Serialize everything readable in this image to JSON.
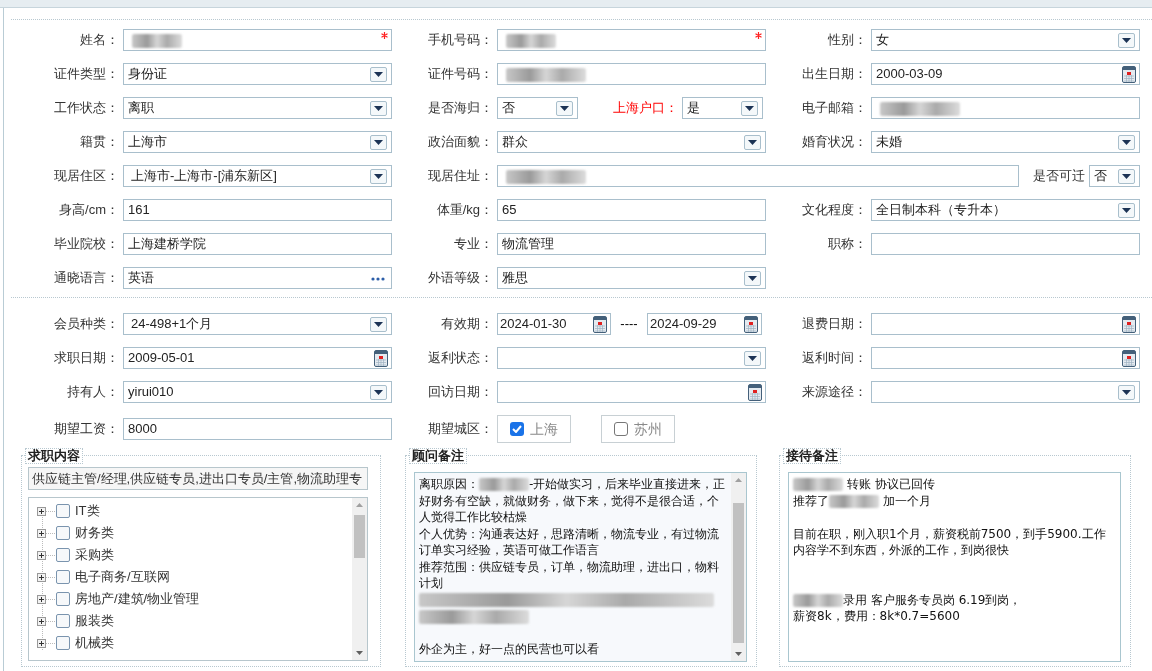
{
  "sections": [
    {
      "rows": [
        [
          {
            "label": "姓名：",
            "control": {
              "kind": "text",
              "redacted": true,
              "required": true
            }
          },
          {
            "label": "手机号码：",
            "control": {
              "kind": "text",
              "redacted": true,
              "required": true
            }
          },
          {
            "label": "性别：",
            "control": {
              "kind": "select",
              "value": "女"
            }
          }
        ],
        [
          {
            "label": "证件类型：",
            "control": {
              "kind": "select",
              "value": "身份证"
            }
          },
          {
            "label": "证件号码：",
            "control": {
              "kind": "text",
              "redacted": true
            }
          },
          {
            "label": "出生日期：",
            "control": {
              "kind": "date",
              "value": "2000-03-09"
            }
          }
        ],
        [
          {
            "label": "工作状态：",
            "control": {
              "kind": "select",
              "value": "离职"
            }
          },
          {
            "label": "是否海归：",
            "control": {
              "kind": "select",
              "value": "否"
            },
            "extra": {
              "label": "上海户口：",
              "alert": true,
              "control": {
                "kind": "select",
                "value": "是"
              }
            }
          },
          {
            "label": "电子邮箱：",
            "control": {
              "kind": "text",
              "redacted": true
            }
          }
        ],
        [
          {
            "label": "籍贯：",
            "control": {
              "kind": "select",
              "value": "上海市"
            }
          },
          {
            "label": "政治面貌：",
            "control": {
              "kind": "select",
              "value": "群众"
            }
          },
          {
            "label": "婚育状况：",
            "control": {
              "kind": "select",
              "value": "未婚"
            }
          }
        ],
        [
          {
            "label": "现居住区：",
            "control": {
              "kind": "select",
              "value": "上海市-上海市-[浦东新区]",
              "linked": true
            }
          },
          {
            "label": "现居住址：",
            "control": {
              "kind": "text",
              "redacted": true
            },
            "extra": {
              "label": "是否可迁",
              "control": {
                "kind": "select",
                "value": "否"
              }
            }
          }
        ],
        [
          {
            "label": "身高/cm：",
            "control": {
              "kind": "text",
              "value": "161"
            }
          },
          {
            "label": "体重/kg：",
            "control": {
              "kind": "text",
              "value": "65"
            }
          },
          {
            "label": "文化程度：",
            "control": {
              "kind": "select",
              "value": "全日制本科（专升本）"
            }
          }
        ],
        [
          {
            "label": "毕业院校：",
            "control": {
              "kind": "text",
              "value": "上海建桥学院"
            }
          },
          {
            "label": "专业：",
            "control": {
              "kind": "text",
              "value": "物流管理"
            }
          },
          {
            "label": "职称：",
            "control": {
              "kind": "text"
            }
          }
        ],
        [
          {
            "label": "通晓语言：",
            "control": {
              "kind": "picker",
              "value": "英语"
            }
          },
          {
            "label": "外语等级：",
            "control": {
              "kind": "select",
              "value": "雅思"
            }
          }
        ]
      ]
    },
    {
      "rows": [
        [
          {
            "label": "会员种类：",
            "control": {
              "kind": "select",
              "value": "24-498+1个月",
              "linked": true
            }
          },
          {
            "label": "有效期：",
            "control": {
              "kind": "date_range",
              "from": "2024-01-30",
              "separator": "----",
              "to": "2024-09-29"
            }
          },
          {
            "label": "退费日期：",
            "control": {
              "kind": "date"
            }
          }
        ],
        [
          {
            "label": "求职日期：",
            "control": {
              "kind": "date",
              "value": "2009-05-01"
            }
          },
          {
            "label": "返利状态：",
            "control": {
              "kind": "select"
            }
          },
          {
            "label": "返利时间：",
            "control": {
              "kind": "date"
            }
          }
        ],
        [
          {
            "label": "持有人：",
            "control": {
              "kind": "select",
              "value": "yirui010"
            }
          },
          {
            "label": "回访日期：",
            "control": {
              "kind": "date"
            }
          },
          {
            "label": "来源途径：",
            "control": {
              "kind": "select"
            }
          }
        ],
        [
          {
            "label": "期望工资：",
            "control": {
              "kind": "text",
              "value": "8000"
            }
          },
          {
            "label": "期望城区：",
            "control": {
              "kind": "checkgroup",
              "options": [
                {
                  "label": "上海",
                  "checked": true
                },
                {
                  "label": "苏州",
                  "checked": false
                }
              ]
            }
          }
        ]
      ]
    }
  ],
  "job_content": {
    "legend": "求职内容",
    "value": "供应链主管/经理,供应链专员,进出口专员/主管,物流助理专",
    "tree": [
      {
        "label": "IT类",
        "checked": false,
        "expanded": false
      },
      {
        "label": "财务类",
        "checked": false,
        "expanded": false
      },
      {
        "label": "采购类",
        "checked": false,
        "expanded": false
      },
      {
        "label": "电子商务/互联网",
        "checked": false,
        "expanded": false
      },
      {
        "label": "房地产/建筑/物业管理",
        "checked": false,
        "expanded": false
      },
      {
        "label": "服装类",
        "checked": false,
        "expanded": false
      },
      {
        "label": "机械类",
        "checked": false,
        "expanded": false
      }
    ]
  },
  "notes": [
    {
      "legend": "顾问备注",
      "scrollbar": true,
      "paragraphs": [
        {
          "kind": "text",
          "parts": [
            {
              "kind": "text",
              "text": "离职原因："
            },
            {
              "kind": "redacted"
            },
            {
              "kind": "text",
              "text": "-开始做实习，后来毕业直接进来，正好财务有空缺，就做财务，做下来，觉得不是很合适，个人觉得工作比较枯燥"
            }
          ]
        },
        {
          "kind": "text",
          "parts": [
            {
              "kind": "text",
              "text": "个人优势：沟通表达好，思路清晰，物流专业，有过物流订单实习经验，英语可做工作语言"
            }
          ]
        },
        {
          "kind": "text",
          "parts": [
            {
              "kind": "text",
              "text": "推荐范围：供应链专员，订单，物流助理，进出口，物料计划"
            }
          ]
        },
        {
          "kind": "redacted"
        },
        {
          "kind": "blank"
        },
        {
          "kind": "text",
          "parts": [
            {
              "kind": "text",
              "text": "外企为主，好一点的民营也可以看"
            }
          ]
        }
      ]
    },
    {
      "legend": "接待备注",
      "scrollbar": false,
      "paragraphs": [
        {
          "kind": "text",
          "parts": [
            {
              "kind": "redacted"
            },
            {
              "kind": "text",
              "text": " 转账 协议已回传"
            }
          ]
        },
        {
          "kind": "text",
          "parts": [
            {
              "kind": "text",
              "text": "推荐了"
            },
            {
              "kind": "redacted"
            },
            {
              "kind": "text",
              "text": " 加一个月"
            }
          ]
        },
        {
          "kind": "blank"
        },
        {
          "kind": "text",
          "parts": [
            {
              "kind": "text",
              "text": "目前在职，刚入职1个月，薪资税前7500，到手5900.工作内容学不到东西，外派的工作，到岗很快"
            }
          ]
        },
        {
          "kind": "blank"
        },
        {
          "kind": "blank"
        },
        {
          "kind": "text",
          "parts": [
            {
              "kind": "redacted"
            },
            {
              "kind": "text",
              "text": "录用 客户服务专员岗 6.19到岗，"
            }
          ]
        },
        {
          "kind": "text",
          "parts": [
            {
              "kind": "text",
              "text": "薪资8k，费用：8k*0.7=5600"
            }
          ]
        }
      ]
    }
  ]
}
